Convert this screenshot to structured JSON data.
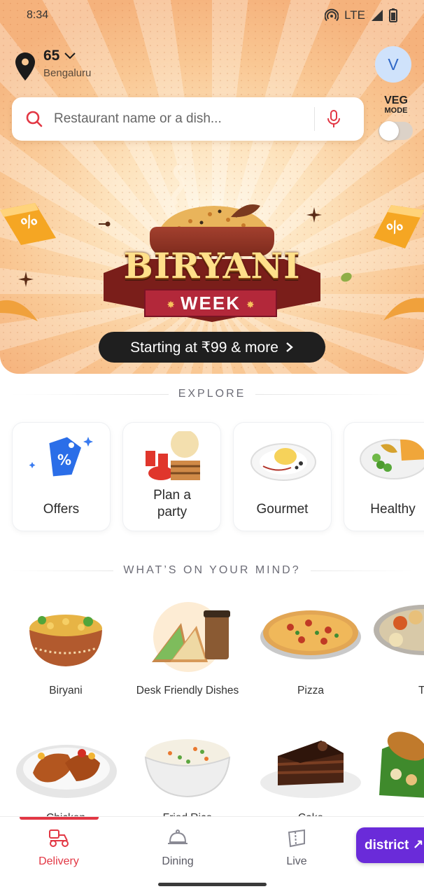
{
  "status_bar": {
    "time": "8:34",
    "network": "LTE"
  },
  "location": {
    "title": "65",
    "subtitle": "Bengaluru"
  },
  "profile": {
    "initial": "V"
  },
  "search": {
    "placeholder": "Restaurant name or a dish..."
  },
  "veg_mode": {
    "line1": "VEG",
    "line2": "MODE",
    "enabled": false
  },
  "banner": {
    "title": "BIRYANI",
    "subtitle": "WEEK",
    "cta": "Starting at ₹99 & more"
  },
  "explore": {
    "heading": "EXPLORE",
    "cards": [
      {
        "label": "Offers",
        "icon": "offer-tag-icon"
      },
      {
        "label": "Plan a party",
        "icon": "party-food-icon"
      },
      {
        "label": "Gourmet",
        "icon": "gourmet-plate-icon"
      },
      {
        "label": "Healthy",
        "icon": "healthy-plate-icon"
      }
    ]
  },
  "mind": {
    "heading": "WHAT’S ON YOUR MIND?",
    "items": [
      {
        "label": "Biryani"
      },
      {
        "label": "Desk Friendly Dishes"
      },
      {
        "label": "Pizza"
      },
      {
        "label": "T"
      },
      {
        "label": "Chicken"
      },
      {
        "label": "Fried Rice"
      },
      {
        "label": "Cake"
      },
      {
        "label": ""
      }
    ]
  },
  "nav": {
    "tabs": [
      {
        "label": "Delivery",
        "active": true
      },
      {
        "label": "Dining",
        "active": false
      },
      {
        "label": "Live",
        "active": false
      }
    ],
    "promo": "district ↗"
  },
  "colors": {
    "accent": "#e23744",
    "district": "#6a2bd9",
    "avatar_bg": "#cfe2fb"
  }
}
